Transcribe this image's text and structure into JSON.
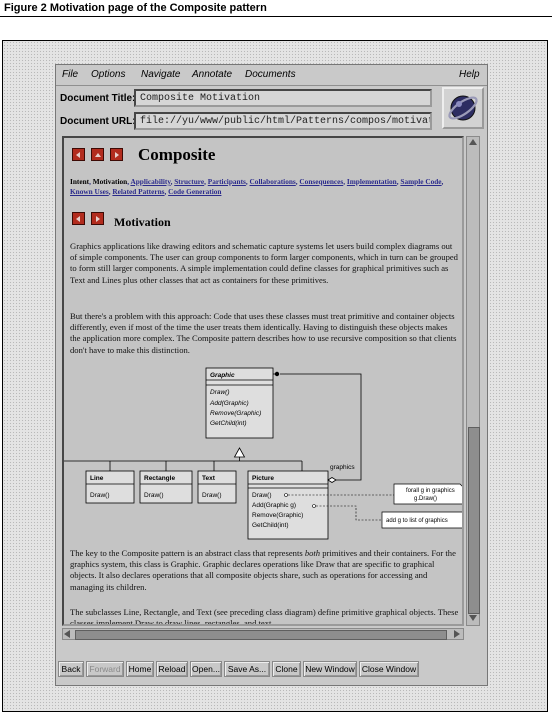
{
  "figure": {
    "caption": "Figure 2    Motivation page of the Composite pattern"
  },
  "menubar": {
    "items": [
      {
        "label": "File"
      },
      {
        "label": "Options"
      },
      {
        "label": "Navigate"
      },
      {
        "label": "Annotate"
      },
      {
        "label": "Documents"
      }
    ],
    "help": "Help"
  },
  "fields": {
    "title_label": "Document Title:",
    "title_value": "Composite Motivation",
    "url_label": "Document URL:",
    "url_value": "file://yu/www/public/html/Patterns/compos/motivat.h"
  },
  "document": {
    "heading": "Composite",
    "links": [
      {
        "text": "Intent",
        "current": false
      },
      {
        "text": "Motivation",
        "current": true
      },
      {
        "text": "Applicability",
        "current": false
      },
      {
        "text": "Structure",
        "current": false
      },
      {
        "text": "Participants",
        "current": false
      },
      {
        "text": "Collaborations",
        "current": false
      },
      {
        "text": "Consequences",
        "current": false
      },
      {
        "text": "Implementation",
        "current": false
      },
      {
        "text": "Sample Code",
        "current": false
      },
      {
        "text": "Known Uses",
        "current": false
      },
      {
        "text": "Related Patterns",
        "current": false
      },
      {
        "text": "Code Generation",
        "current": false
      }
    ],
    "section_heading": "Motivation",
    "para1": "Graphics applications like drawing editors and schematic capture systems let users build complex diagrams out of simple components. The user can group components to form larger components, which in turn can be grouped to form still larger components. A simple implementation could define classes for graphical primitives such as Text and Lines plus other classes that act as containers for these primitives.",
    "para2": "But there's a problem with this approach: Code that uses these classes must treat primitive and container objects differently, even if most of the time the user treats them identically. Having to distinguish these objects makes the application more complex. The Composite pattern describes how to use recursive composition so that clients don't have to make this distinction.",
    "para3_a": "The key to the Composite pattern is an abstract class that represents ",
    "para3_em": "both",
    "para3_b": " primitives and their containers. For the graphics system, this class is Graphic. Graphic declares operations like Draw that are specific to graphical objects. It also declares operations that all composite objects share, such as operations for accessing and managing its children.",
    "para4": "The subclasses Line, Rectangle, and Text (see preceding class diagram) define primitive graphical objects. These classes implement Draw to draw lines, rectangles, and text,",
    "diagram": {
      "graphic_name": "Graphic",
      "graphic_ops": [
        "Draw()",
        "Add(Graphic)",
        "Remove(Graphic)",
        "GetChild(int)"
      ],
      "line_name": "Line",
      "line_ops": [
        "Draw()"
      ],
      "rect_name": "Rectangle",
      "rect_ops": [
        "Draw()"
      ],
      "text_name": "Text",
      "text_ops": [
        "Draw()"
      ],
      "picture_name": "Picture",
      "picture_ops": [
        "Draw()",
        "Add(Graphic g)",
        "Remove(Graphic)",
        "GetChild(int)"
      ],
      "assoc_label": "graphics",
      "note1_l1": "forall g in graphics",
      "note1_l2": "g.Draw()",
      "note2": "add g to list of graphics"
    }
  },
  "buttons": [
    {
      "label": "Back",
      "enabled": true
    },
    {
      "label": "Forward",
      "enabled": false
    },
    {
      "label": "Home",
      "enabled": true
    },
    {
      "label": "Reload",
      "enabled": true
    },
    {
      "label": "Open...",
      "enabled": true
    },
    {
      "label": "Save As...",
      "enabled": true
    },
    {
      "label": "Clone",
      "enabled": true
    },
    {
      "label": "New Window",
      "enabled": true
    },
    {
      "label": "Close Window",
      "enabled": true
    }
  ],
  "colors": {
    "nav_button": "#b22c1e",
    "link": "#2b2b8c",
    "window": "#c9c9c9"
  }
}
